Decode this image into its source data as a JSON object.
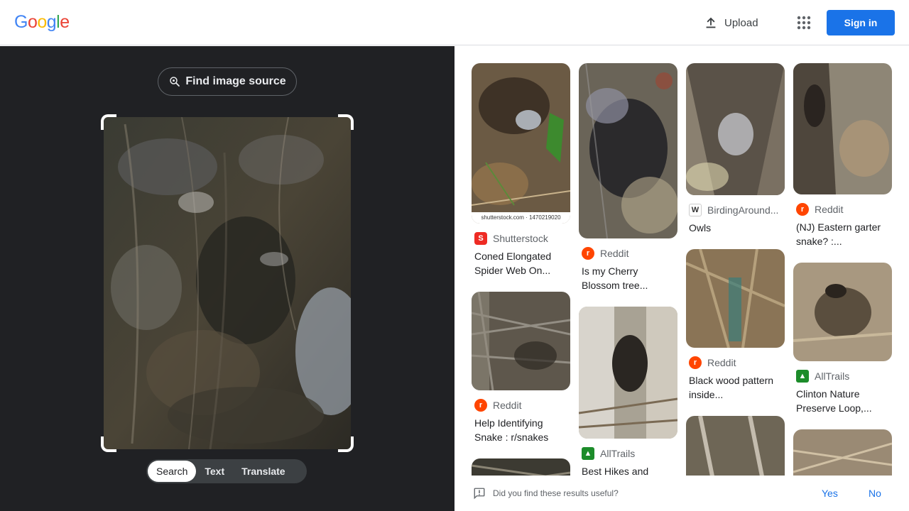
{
  "header": {
    "logo": "Google",
    "upload_label": "Upload",
    "signin_label": "Sign in"
  },
  "lens": {
    "find_source_label": "Find image source",
    "modes": [
      "Search",
      "Text",
      "Translate"
    ],
    "active_mode": "Search"
  },
  "results": {
    "columns": [
      [
        {
          "source": "Shutterstock",
          "title": "Coned Elongated Spider Web On...",
          "icon": "shutterstock-icon",
          "watermark": "shutterstock.com · 1470219020"
        },
        {
          "source": "Reddit",
          "title": "Help Identifying Snake : r/snakes",
          "icon": "reddit-icon"
        }
      ],
      [
        {
          "source": "Reddit",
          "title": "Is my Cherry Blossom tree...",
          "icon": "reddit-icon"
        },
        {
          "source": "AllTrails",
          "title": "Best Hikes and",
          "icon": "alltrails-icon"
        }
      ],
      [
        {
          "source": "BirdingAround...",
          "title": "Owls",
          "icon": "weebly-icon"
        },
        {
          "source": "Reddit",
          "title": "Black wood pattern inside...",
          "icon": "reddit-icon"
        }
      ],
      [
        {
          "source": "Reddit",
          "title": "(NJ) Eastern garter snake? :...",
          "icon": "reddit-icon"
        },
        {
          "source": "AllTrails",
          "title": "Clinton Nature Preserve Loop,...",
          "icon": "alltrails-icon"
        }
      ]
    ]
  },
  "feedback": {
    "question": "Did you find these results useful?",
    "yes": "Yes",
    "no": "No"
  },
  "colors": {
    "accent": "#1a73e8",
    "dark_panel": "#202124",
    "reddit": "#ff4500",
    "alltrails": "#1c8c2a",
    "shutterstock": "#ee2b24"
  }
}
